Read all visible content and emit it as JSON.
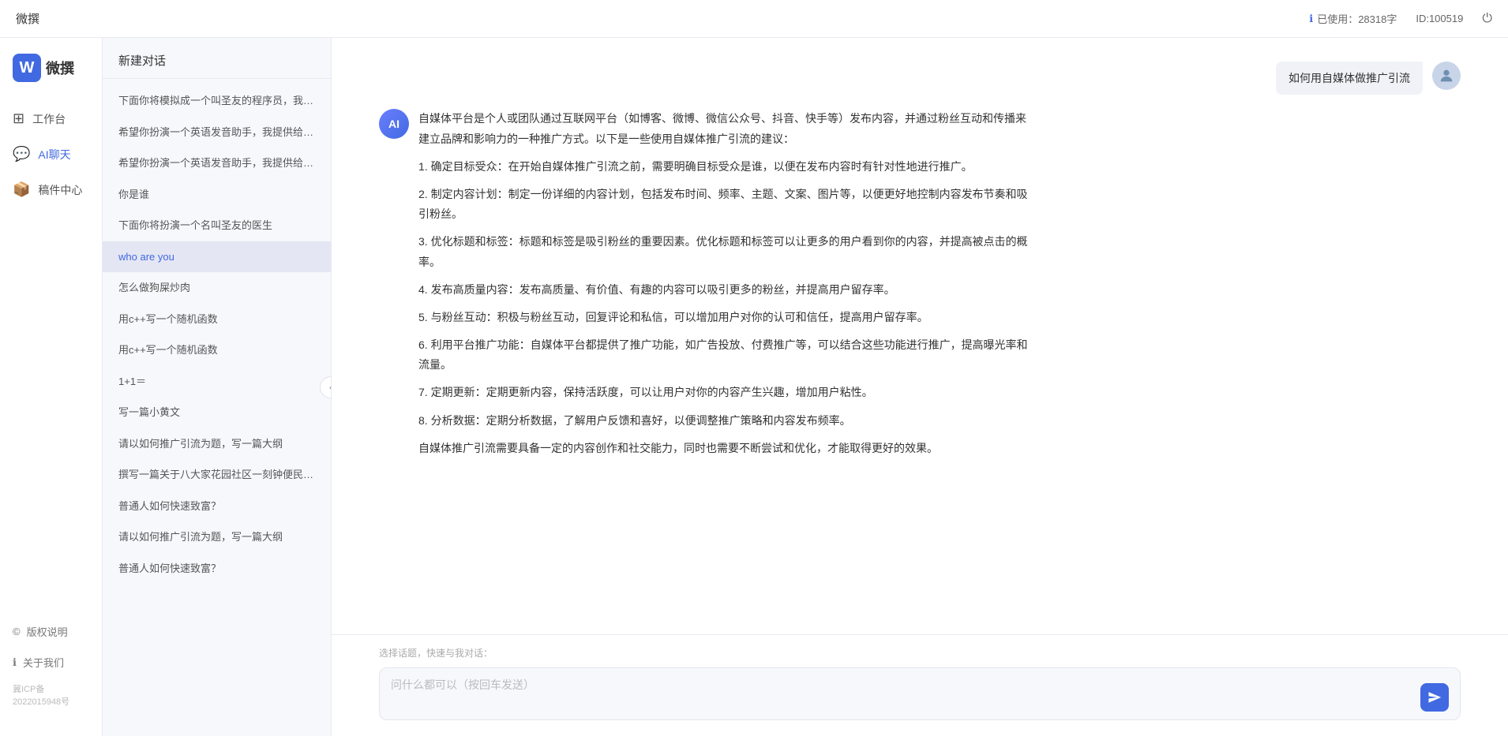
{
  "app": {
    "title": "微撰",
    "logo_letter": "W",
    "logo_text": "微撰"
  },
  "topbar": {
    "title": "微撰",
    "usage_icon": "ℹ",
    "usage_label": "已使用：28318字",
    "id_label": "ID:100519",
    "power_icon": "⏻"
  },
  "nav": {
    "items": [
      {
        "id": "workbench",
        "icon": "⊞",
        "label": "工作台"
      },
      {
        "id": "aichat",
        "icon": "💬",
        "label": "AI聊天"
      },
      {
        "id": "components",
        "icon": "📦",
        "label": "稿件中心"
      }
    ],
    "bottom_items": [
      {
        "id": "copyright",
        "icon": "©",
        "label": "版权说明"
      },
      {
        "id": "about",
        "icon": "ℹ",
        "label": "关于我们"
      }
    ],
    "beian": "冀ICP备2022015948号"
  },
  "history": {
    "new_chat_label": "新建对话",
    "items": [
      {
        "id": 1,
        "text": "下面你将模拟成一个叫圣友的程序员，我说..."
      },
      {
        "id": 2,
        "text": "希望你扮演一个英语发音助手，我提供给你..."
      },
      {
        "id": 3,
        "text": "希望你扮演一个英语发音助手，我提供给你..."
      },
      {
        "id": 4,
        "text": "你是谁"
      },
      {
        "id": 5,
        "text": "下面你将扮演一个名叫圣友的医生"
      },
      {
        "id": 6,
        "text": "who are you"
      },
      {
        "id": 7,
        "text": "怎么做狗屎炒肉"
      },
      {
        "id": 8,
        "text": "用c++写一个随机函数"
      },
      {
        "id": 9,
        "text": "用c++写一个随机函数"
      },
      {
        "id": 10,
        "text": "1+1＝"
      },
      {
        "id": 11,
        "text": "写一篇小黄文"
      },
      {
        "id": 12,
        "text": "请以如何推广引流为题，写一篇大纲"
      },
      {
        "id": 13,
        "text": "撰写一篇关于八大家花园社区一刻钟便民生..."
      },
      {
        "id": 14,
        "text": "普通人如何快速致富？"
      },
      {
        "id": 15,
        "text": "请以如何推广引流为题，写一篇大纲"
      },
      {
        "id": 16,
        "text": "普通人如何快速致富？"
      }
    ]
  },
  "chat": {
    "user_message": "如何用自媒体做推广引流",
    "ai_response": {
      "paragraphs": [
        "自媒体平台是个人或团队通过互联网平台（如博客、微博、微信公众号、抖音、快手等）发布内容，并通过粉丝互动和传播来建立品牌和影响力的一种推广方式。以下是一些使用自媒体推广引流的建议：",
        "1. 确定目标受众：在开始自媒体推广引流之前，需要明确目标受众是谁，以便在发布内容时有针对性地进行推广。",
        "2. 制定内容计划：制定一份详细的内容计划，包括发布时间、频率、主题、文案、图片等，以便更好地控制内容发布节奏和吸引粉丝。",
        "3. 优化标题和标签：标题和标签是吸引粉丝的重要因素。优化标题和标签可以让更多的用户看到你的内容，并提高被点击的概率。",
        "4. 发布高质量内容：发布高质量、有价值、有趣的内容可以吸引更多的粉丝，并提高用户留存率。",
        "5. 与粉丝互动：积极与粉丝互动，回复评论和私信，可以增加用户对你的认可和信任，提高用户留存率。",
        "6. 利用平台推广功能：自媒体平台都提供了推广功能，如广告投放、付费推广等，可以结合这些功能进行推广，提高曝光率和流量。",
        "7. 定期更新：定期更新内容，保持活跃度，可以让用户对你的内容产生兴趣，增加用户粘性。",
        "8. 分析数据：定期分析数据，了解用户反馈和喜好，以便调整推广策略和内容发布频率。",
        "自媒体推广引流需要具备一定的内容创作和社交能力，同时也需要不断尝试和优化，才能取得更好的效果。"
      ]
    },
    "quick_topics_label": "选择话题，快速与我对话：",
    "input_placeholder": "问什么都可以（按回车发送）"
  }
}
